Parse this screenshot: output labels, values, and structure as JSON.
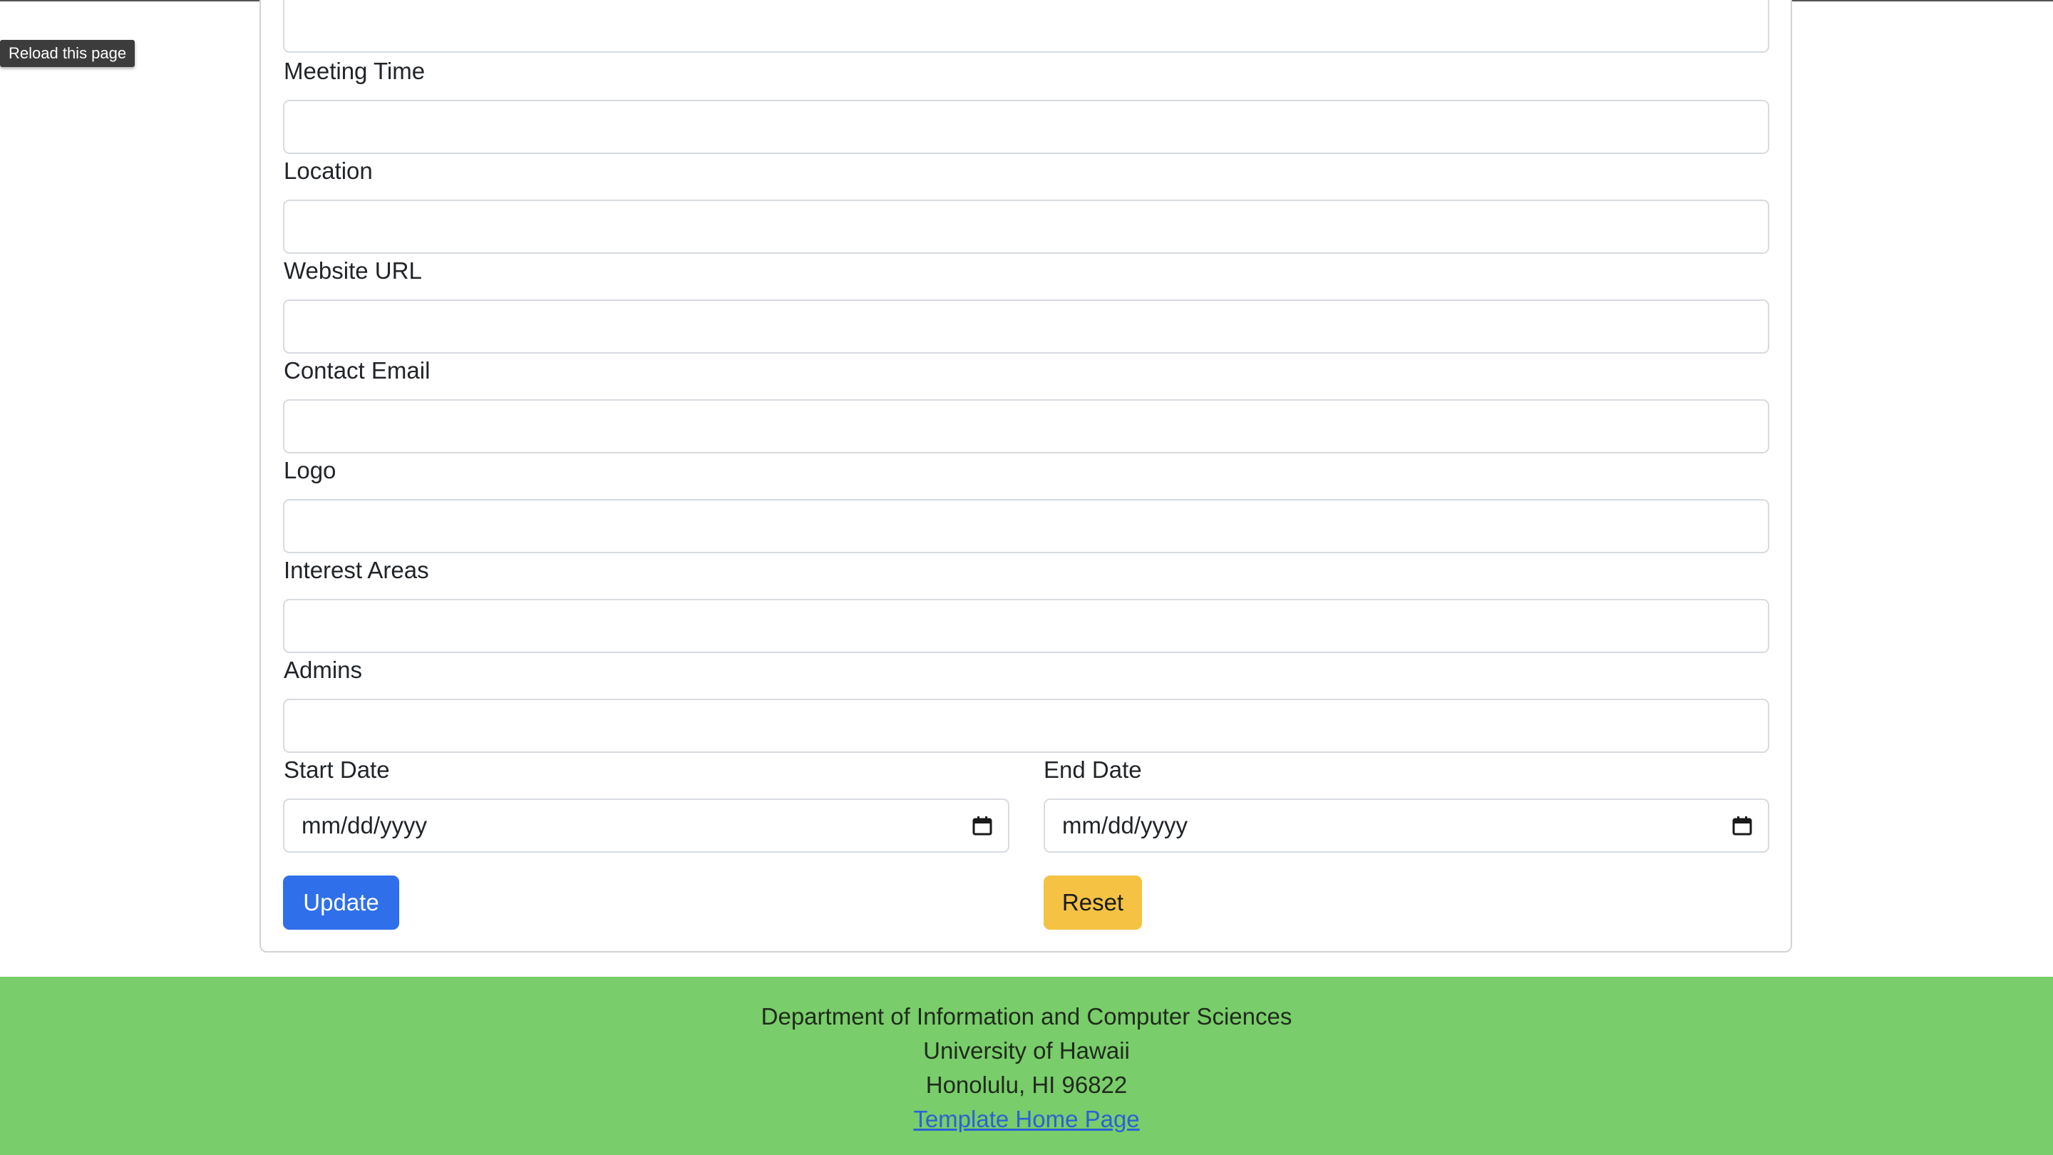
{
  "browser": {
    "tooltip": "Reload this page"
  },
  "form": {
    "fields": [
      {
        "label": "",
        "value": ""
      },
      {
        "label": "Meeting Time",
        "value": ""
      },
      {
        "label": "Location",
        "value": ""
      },
      {
        "label": "Website URL",
        "value": ""
      },
      {
        "label": "Contact Email",
        "value": ""
      },
      {
        "label": "Logo",
        "value": ""
      },
      {
        "label": "Interest Areas",
        "value": ""
      },
      {
        "label": "Admins",
        "value": ""
      }
    ],
    "start_date": {
      "label": "Start Date",
      "placeholder": "mm/dd/yyyy"
    },
    "end_date": {
      "label": "End Date",
      "placeholder": "mm/dd/yyyy"
    },
    "update_label": "Update",
    "reset_label": "Reset",
    "colors": {
      "update": "#2f6fea",
      "reset": "#f5c244"
    }
  },
  "footer": {
    "line1": "Department of Information and Computer Sciences",
    "line2": "University of Hawaii",
    "line3": "Honolulu, HI 96822",
    "link": "Template Home Page",
    "background": "#79cd6a"
  }
}
